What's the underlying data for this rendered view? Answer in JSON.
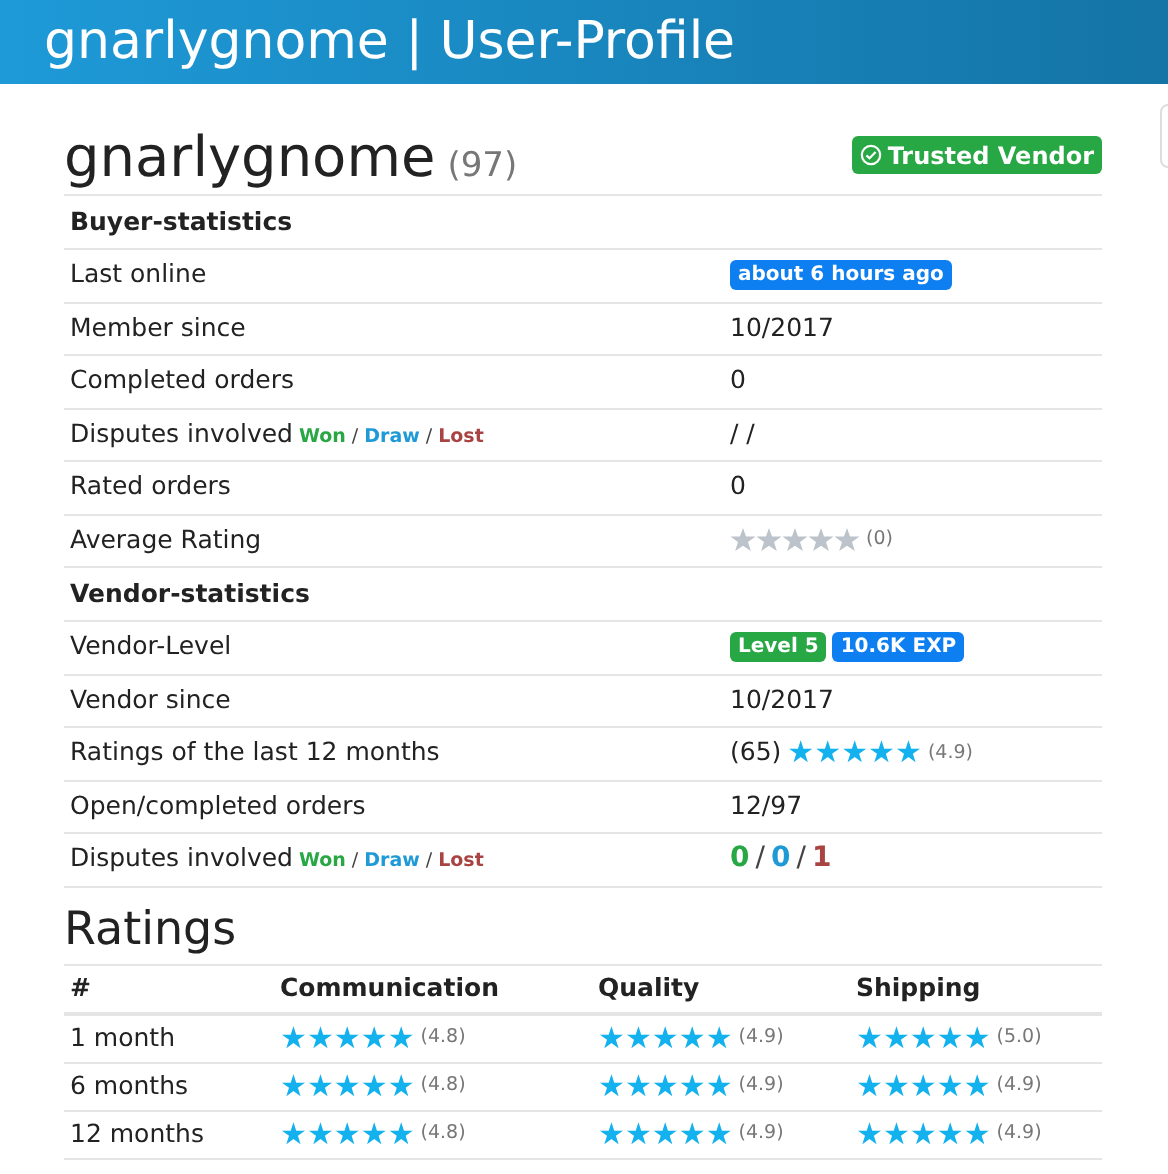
{
  "header": {
    "title": "gnarlygnome | User-Profile"
  },
  "profile": {
    "name": "gnarlygnome",
    "count": "(97)",
    "badge": "Trusted Vendor"
  },
  "sections": [
    {
      "title": "Buyer-statistics",
      "rows": [
        {
          "label": "Last online",
          "kind": "badges",
          "badges": [
            {
              "text": "about 6 hours ago",
              "color": "#0d7ff0"
            }
          ]
        },
        {
          "label": "Member since",
          "kind": "text",
          "value": "10/2017"
        },
        {
          "label": "Completed orders",
          "kind": "text",
          "value": "0"
        },
        {
          "label": "Disputes involved",
          "legend": [
            {
              "text": "Won",
              "kind": "won"
            },
            {
              "text": "/",
              "kind": "sep"
            },
            {
              "text": "Draw",
              "kind": "draw"
            },
            {
              "text": "/",
              "kind": "sep"
            },
            {
              "text": "Lost",
              "kind": "lost"
            }
          ],
          "kind": "text",
          "value": "/ /"
        },
        {
          "label": "Rated orders",
          "kind": "text",
          "value": "0"
        },
        {
          "label": "Average Rating",
          "kind": "stars",
          "stars": 0,
          "score": "(0)"
        }
      ]
    },
    {
      "title": "Vendor-statistics",
      "rows": [
        {
          "label": "Vendor-Level",
          "kind": "badges",
          "badges": [
            {
              "text": "Level 5",
              "color": "#28a745"
            },
            {
              "text": "10.6K EXP",
              "color": "#0d7ff0"
            }
          ]
        },
        {
          "label": "Vendor since",
          "kind": "text",
          "value": "10/2017"
        },
        {
          "label": "Ratings of the last 12 months",
          "kind": "stars",
          "prefix": "(65)",
          "stars": 5,
          "score": "(4.9)"
        },
        {
          "label": "Open/completed orders",
          "kind": "text",
          "value": "12/97"
        },
        {
          "label": "Disputes involved",
          "legend": [
            {
              "text": "Won",
              "kind": "won"
            },
            {
              "text": "/",
              "kind": "sep"
            },
            {
              "text": "Draw",
              "kind": "draw"
            },
            {
              "text": "/",
              "kind": "sep"
            },
            {
              "text": "Lost",
              "kind": "lost"
            }
          ],
          "kind": "disputes",
          "counts": [
            {
              "text": "0",
              "kind": "won"
            },
            {
              "text": "/",
              "kind": "sep"
            },
            {
              "text": "0",
              "kind": "draw"
            },
            {
              "text": "/",
              "kind": "sep"
            },
            {
              "text": "1",
              "kind": "lost"
            }
          ]
        }
      ]
    }
  ],
  "ratings": {
    "title": "Ratings",
    "columns": [
      "#",
      "Communication",
      "Quality",
      "Shipping"
    ],
    "rows": [
      {
        "cells": [
          {
            "kind": "text",
            "text": "1 month"
          },
          {
            "kind": "stars",
            "stars": 5,
            "score": "(4.8)"
          },
          {
            "kind": "stars",
            "stars": 5,
            "score": "(4.9)"
          },
          {
            "kind": "stars",
            "stars": 5,
            "score": "(5.0)"
          }
        ]
      },
      {
        "cells": [
          {
            "kind": "text",
            "text": "6 months"
          },
          {
            "kind": "stars",
            "stars": 5,
            "score": "(4.8)"
          },
          {
            "kind": "stars",
            "stars": 5,
            "score": "(4.9)"
          },
          {
            "kind": "stars",
            "stars": 5,
            "score": "(4.9)"
          }
        ]
      },
      {
        "cells": [
          {
            "kind": "text",
            "text": "12 months"
          },
          {
            "kind": "stars",
            "stars": 5,
            "score": "(4.8)"
          },
          {
            "kind": "stars",
            "stars": 5,
            "score": "(4.9)"
          },
          {
            "kind": "stars",
            "stars": 5,
            "score": "(4.9)"
          }
        ]
      }
    ]
  }
}
